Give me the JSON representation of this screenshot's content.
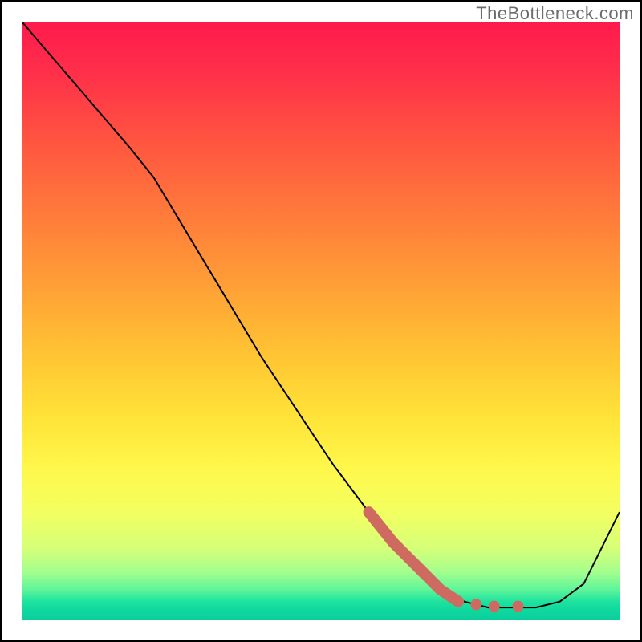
{
  "watermark": "TheBottleneck.com",
  "chart_data": {
    "type": "line",
    "title": "",
    "xlabel": "",
    "ylabel": "",
    "xlim": [
      0,
      100
    ],
    "ylim": [
      0,
      100
    ],
    "grid": false,
    "legend": false,
    "series": [
      {
        "name": "curve",
        "color": "#000000",
        "stroke_width": 2,
        "x": [
          0,
          6,
          12,
          18,
          22,
          28,
          34,
          40,
          46,
          52,
          58,
          62,
          66,
          70,
          74,
          78,
          82,
          86,
          90,
          94,
          100
        ],
        "y": [
          100,
          93,
          86,
          79,
          74,
          64,
          54,
          44,
          35,
          26,
          18,
          13,
          9,
          5,
          3,
          2,
          2,
          2,
          3,
          6,
          18
        ]
      }
    ],
    "highlight": {
      "name": "thick-segment",
      "color": "#cf6a61",
      "stroke_width": 14,
      "x": [
        58,
        62,
        66,
        70,
        73
      ],
      "y": [
        18,
        13,
        9,
        5,
        3
      ]
    },
    "dots": {
      "name": "highlight-dots",
      "color": "#cf6a61",
      "radius": 7,
      "points": [
        {
          "x": 76,
          "y": 2.5
        },
        {
          "x": 79,
          "y": 2.2
        },
        {
          "x": 83,
          "y": 2.2
        }
      ]
    }
  }
}
